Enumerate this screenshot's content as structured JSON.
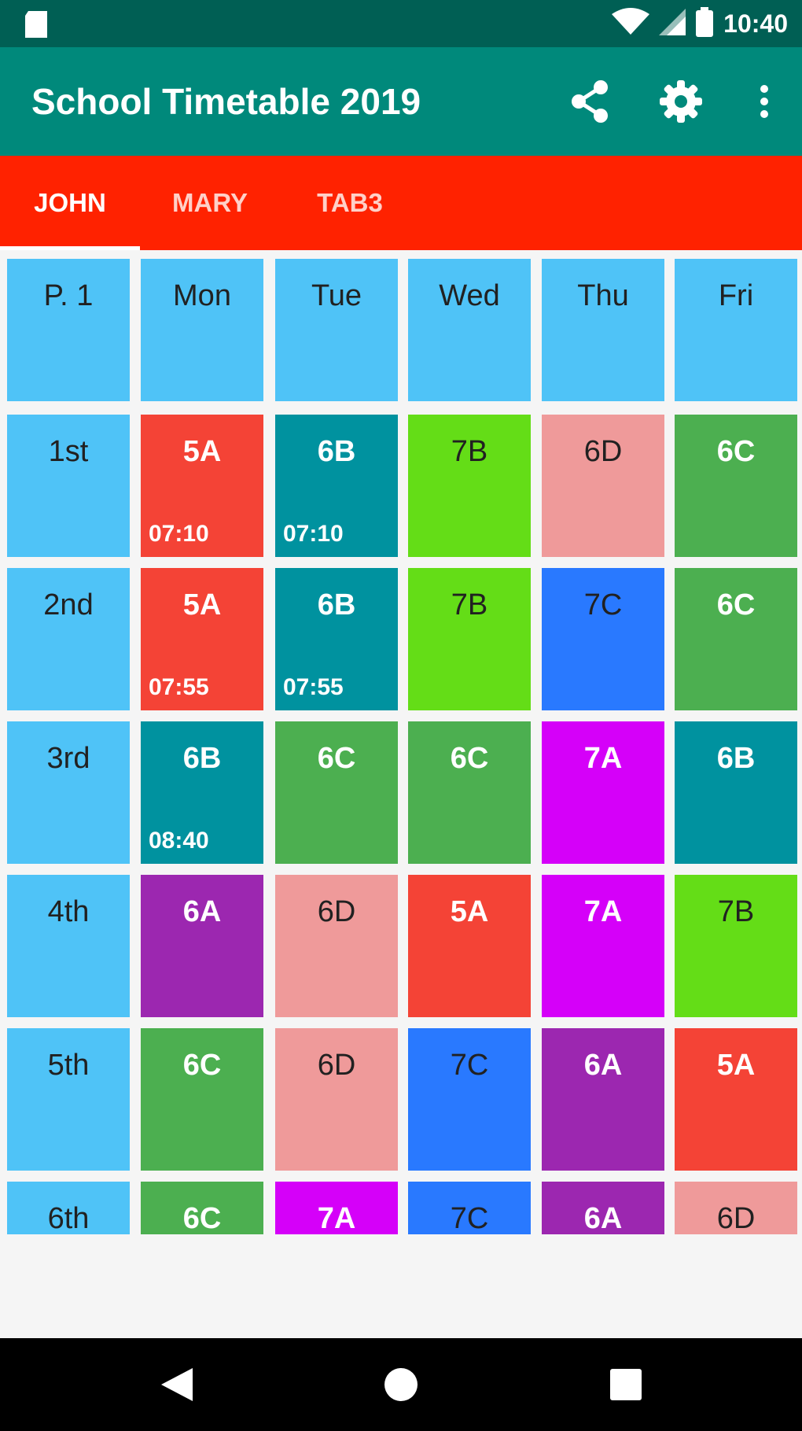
{
  "status_bar": {
    "time": "10:40"
  },
  "app_bar": {
    "title": "School Timetable 2019",
    "icons": [
      "share-icon",
      "settings-gear-icon",
      "more-vert-icon"
    ]
  },
  "tabs": [
    {
      "label": "JOHN",
      "active": true
    },
    {
      "label": "MARY",
      "active": false
    },
    {
      "label": "TAB3",
      "active": false
    }
  ],
  "timetable": {
    "header": [
      "P. 1",
      "Mon",
      "Tue",
      "Wed",
      "Thu",
      "Fri"
    ],
    "rows": [
      {
        "period": "1st",
        "cells": [
          {
            "label": "5A",
            "time": "07:10",
            "color": "#f44336"
          },
          {
            "label": "6B",
            "time": "07:10",
            "color": "#00929f"
          },
          {
            "label": "7B",
            "time": "",
            "color": "#64dd17"
          },
          {
            "label": "6D",
            "time": "",
            "color": "#ef9a9a"
          },
          {
            "label": "6C",
            "time": "",
            "color": "#4caf50"
          }
        ]
      },
      {
        "period": "2nd",
        "cells": [
          {
            "label": "5A",
            "time": "07:55",
            "color": "#f44336"
          },
          {
            "label": "6B",
            "time": "07:55",
            "color": "#00929f"
          },
          {
            "label": "7B",
            "time": "",
            "color": "#64dd17"
          },
          {
            "label": "7C",
            "time": "",
            "color": "#2979ff"
          },
          {
            "label": "6C",
            "time": "",
            "color": "#4caf50"
          }
        ]
      },
      {
        "period": "3rd",
        "cells": [
          {
            "label": "6B",
            "time": "08:40",
            "color": "#00929f"
          },
          {
            "label": "6C",
            "time": "",
            "color": "#4caf50"
          },
          {
            "label": "6C",
            "time": "",
            "color": "#4caf50"
          },
          {
            "label": "7A",
            "time": "",
            "color": "#d500f9"
          },
          {
            "label": "6B",
            "time": "",
            "color": "#00929f"
          }
        ]
      },
      {
        "period": "4th",
        "cells": [
          {
            "label": "6A",
            "time": "",
            "color": "#9c27b0"
          },
          {
            "label": "6D",
            "time": "",
            "color": "#ef9a9a"
          },
          {
            "label": "5A",
            "time": "",
            "color": "#f44336"
          },
          {
            "label": "7A",
            "time": "",
            "color": "#d500f9"
          },
          {
            "label": "7B",
            "time": "",
            "color": "#64dd17"
          }
        ]
      },
      {
        "period": "5th",
        "cells": [
          {
            "label": "6C",
            "time": "",
            "color": "#4caf50"
          },
          {
            "label": "6D",
            "time": "",
            "color": "#ef9a9a"
          },
          {
            "label": "7C",
            "time": "",
            "color": "#2979ff"
          },
          {
            "label": "6A",
            "time": "",
            "color": "#9c27b0"
          },
          {
            "label": "5A",
            "time": "",
            "color": "#f44336"
          }
        ]
      },
      {
        "period": "6th",
        "cells": [
          {
            "label": "6C",
            "time": "",
            "color": "#4caf50"
          },
          {
            "label": "7A",
            "time": "",
            "color": "#d500f9"
          },
          {
            "label": "7C",
            "time": "",
            "color": "#2979ff"
          },
          {
            "label": "6A",
            "time": "",
            "color": "#9c27b0"
          },
          {
            "label": "6D",
            "time": "",
            "color": "#ef9a9a"
          }
        ]
      }
    ]
  },
  "colors": {
    "status_bar": "#005f54",
    "app_bar": "#00897b",
    "tab_bar": "#ff2200",
    "period_cell": "#4fc3f7",
    "background": "#f5f5f5"
  },
  "nav_bar": {
    "icons": [
      "back-icon",
      "home-icon",
      "recents-icon"
    ]
  }
}
